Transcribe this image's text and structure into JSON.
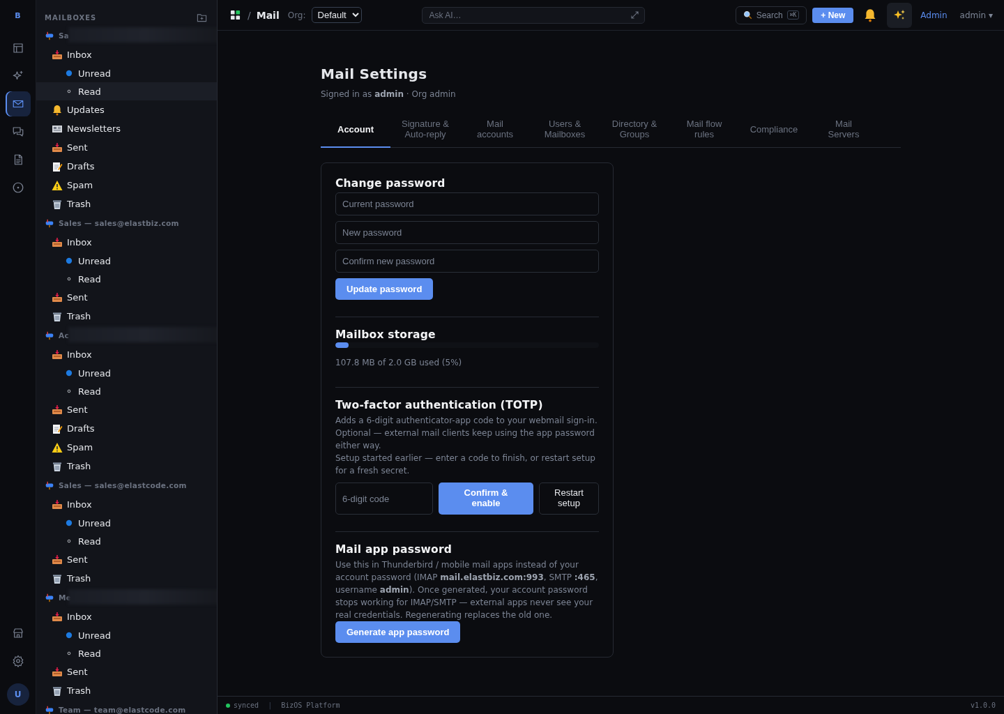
{
  "rail": {
    "logo": "B",
    "items": [
      {
        "kind": "table",
        "selected": false
      },
      {
        "kind": "sparkles",
        "selected": false
      },
      {
        "kind": "mail",
        "selected": true
      },
      {
        "kind": "chat",
        "selected": false
      },
      {
        "kind": "document",
        "selected": false
      },
      {
        "kind": "target",
        "selected": false
      }
    ],
    "bottom_items": [
      {
        "kind": "store",
        "selected": false
      },
      {
        "kind": "settings",
        "selected": false
      }
    ],
    "avatar": "U"
  },
  "mailboxes": {
    "title": "MAILBOXES",
    "groups": [
      {
        "title": "Sa",
        "redacted": true,
        "items": [
          {
            "label": "Inbox",
            "kind": "inbox",
            "selected": false,
            "children": [
              {
                "label": "Unread",
                "kind": "unread",
                "selected": false
              },
              {
                "label": "Read",
                "kind": "read",
                "selected": true
              }
            ]
          },
          {
            "label": "Updates",
            "kind": "bell",
            "selected": false
          },
          {
            "label": "Newsletters",
            "kind": "newspaper",
            "selected": false
          },
          {
            "label": "Sent",
            "kind": "inbox",
            "selected": false
          },
          {
            "label": "Drafts",
            "kind": "memo",
            "selected": false
          },
          {
            "label": "Spam",
            "kind": "warning",
            "selected": false
          },
          {
            "label": "Trash",
            "kind": "trash",
            "selected": false
          }
        ]
      },
      {
        "title": "Sales — sales@elastbiz.com",
        "redacted": false,
        "items": [
          {
            "label": "Inbox",
            "kind": "inbox",
            "selected": false,
            "children": [
              {
                "label": "Unread",
                "kind": "unread",
                "selected": false
              },
              {
                "label": "Read",
                "kind": "read",
                "selected": false
              }
            ]
          },
          {
            "label": "Sent",
            "kind": "inbox",
            "selected": false
          },
          {
            "label": "Trash",
            "kind": "trash",
            "selected": false
          }
        ]
      },
      {
        "title": "Ac",
        "redacted": true,
        "items": [
          {
            "label": "Inbox",
            "kind": "inbox",
            "selected": false,
            "children": [
              {
                "label": "Unread",
                "kind": "unread",
                "selected": false
              },
              {
                "label": "Read",
                "kind": "read",
                "selected": false
              }
            ]
          },
          {
            "label": "Sent",
            "kind": "inbox",
            "selected": false
          },
          {
            "label": "Drafts",
            "kind": "memo",
            "selected": false
          },
          {
            "label": "Spam",
            "kind": "warning",
            "selected": false
          },
          {
            "label": "Trash",
            "kind": "trash",
            "selected": false
          }
        ]
      },
      {
        "title": "Sales — sales@elastcode.com",
        "redacted": false,
        "items": [
          {
            "label": "Inbox",
            "kind": "inbox",
            "selected": false,
            "children": [
              {
                "label": "Unread",
                "kind": "unread",
                "selected": false
              },
              {
                "label": "Read",
                "kind": "read",
                "selected": false
              }
            ]
          },
          {
            "label": "Sent",
            "kind": "inbox",
            "selected": false
          },
          {
            "label": "Trash",
            "kind": "trash",
            "selected": false
          }
        ]
      },
      {
        "title": "Me",
        "redacted": true,
        "items": [
          {
            "label": "Inbox",
            "kind": "inbox",
            "selected": false,
            "children": [
              {
                "label": "Unread",
                "kind": "unread",
                "selected": false
              },
              {
                "label": "Read",
                "kind": "read",
                "selected": false
              }
            ]
          },
          {
            "label": "Sent",
            "kind": "inbox",
            "selected": false
          },
          {
            "label": "Trash",
            "kind": "trash",
            "selected": false
          }
        ]
      },
      {
        "title": "Team — team@elastcode.com",
        "redacted": false
      }
    ]
  },
  "topbar": {
    "separator": "/",
    "app": "Mail",
    "org_label": "Org:",
    "org_value": "Default",
    "ask_placeholder": "Ask AI…",
    "search": "Search",
    "search_key": "⌘K",
    "new_button": "+ New",
    "admin_link": "Admin",
    "user_menu": "admin ▾"
  },
  "page": {
    "title": "Mail Settings",
    "subtitle": "Signed in as **admin** · Org admin",
    "tabs": [
      {
        "label": "Account",
        "selected": true
      },
      {
        "label": "Signature & Auto-reply",
        "selected": false
      },
      {
        "label": "Mail accounts",
        "selected": false
      },
      {
        "label": "Users & Mailboxes",
        "selected": false
      },
      {
        "label": "Directory & Groups",
        "selected": false
      },
      {
        "label": "Mail flow rules",
        "selected": false
      },
      {
        "label": "Compliance",
        "selected": false
      },
      {
        "label": "Mail Servers",
        "selected": false
      }
    ],
    "password": {
      "title": "Change password",
      "fields": [
        {
          "placeholder": "Current password"
        },
        {
          "placeholder": "New password"
        },
        {
          "placeholder": "Confirm new password"
        }
      ],
      "button": "Update password"
    },
    "storage": {
      "title": "Mailbox storage",
      "level": 0.05,
      "reading": "107.8 MB of 2.0 GB used (5%)"
    },
    "totp": {
      "title": "Two-factor authentication (TOTP)",
      "lines": [
        "Adds a 6-digit authenticator-app code to your webmail sign-in. Optional — external mail clients keep using the app password either way.",
        "Setup started earlier — enter a code to finish, or restart setup for a fresh secret."
      ],
      "code_placeholder": "6-digit code",
      "confirm_button": "Confirm & enable",
      "restart_button": "Restart setup"
    },
    "app_password": {
      "title": "Mail app password",
      "text": "Use this in Thunderbird / mobile mail apps instead of your account password (IMAP **mail.elastbiz.com:993**, SMTP **:465**, username **admin**). Once generated, your account password stops working for IMAP/SMTP — external apps never see your real credentials. Regenerating replaces the old one.",
      "button": "Generate app password"
    }
  },
  "status_bar": {
    "state": "synced",
    "separator": "|",
    "platform": "BizOS Platform",
    "version": "v1.0.0"
  }
}
